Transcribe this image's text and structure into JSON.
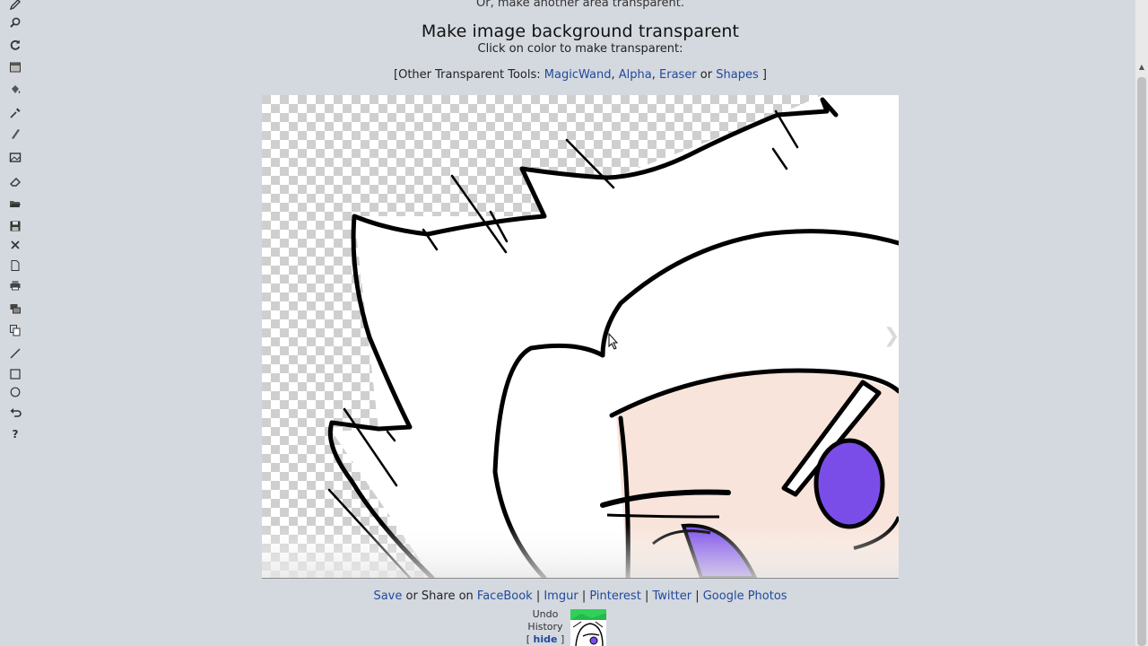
{
  "top_note": "Or, make another area transparent.",
  "title": "Make image background transparent",
  "instruction": "Click on color to make transparent:",
  "other_tools": {
    "prefix": "[Other Transparent Tools:",
    "links": [
      "MagicWand",
      "Alpha",
      "Eraser",
      "Shapes"
    ],
    "separator": ",",
    "or": "or",
    "suffix": "]"
  },
  "share": {
    "save": "Save",
    "or_share_on": "or Share on",
    "services": [
      "FaceBook",
      "Imgur",
      "Pinterest",
      "Twitter",
      "Google Photos"
    ],
    "divider": "|"
  },
  "undo": {
    "line1": "Undo",
    "line2": "History",
    "hide": "hide",
    "bracket_open": "[",
    "bracket_close": "]"
  },
  "toolbar_icons": [
    "pencil-icon",
    "zoom-icon",
    "rotate-icon",
    "crop-icon",
    "bucket-icon",
    "eyedropper-icon",
    "brush-icon",
    "image-layers-icon",
    "eraser-icon",
    "open-folder-icon",
    "save-disk-icon",
    "close-icon",
    "new-file-icon",
    "print-icon",
    "layers-icon",
    "copy-icon",
    "line-icon",
    "rectangle-icon",
    "circle-icon",
    "undo-icon",
    "help-icon"
  ],
  "colors": {
    "link": "#1f4a9a",
    "page_bg": "#d4d8df",
    "eye": "#7b4de8",
    "skin": "#f8e4da"
  }
}
